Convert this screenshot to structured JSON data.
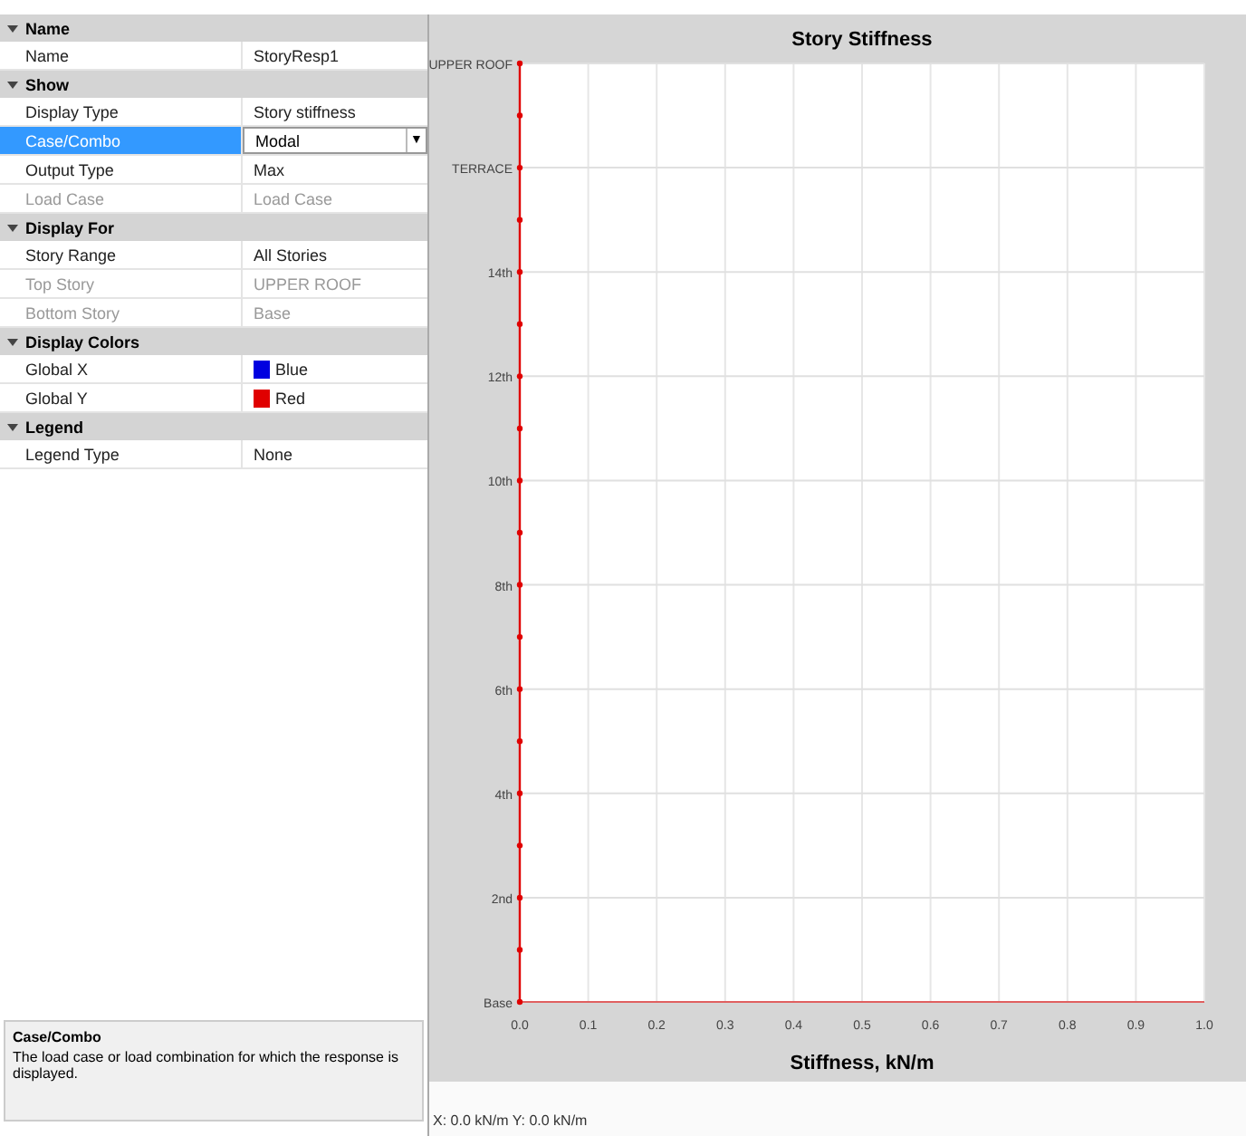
{
  "properties": [
    {
      "kind": "header",
      "label": "Name",
      "expanded": true
    },
    {
      "kind": "text",
      "label": "Name",
      "value": "StoryResp1",
      "disabled": false,
      "selected": false
    },
    {
      "kind": "header",
      "label": "Show",
      "expanded": true
    },
    {
      "kind": "text",
      "label": "Display Type",
      "value": "Story stiffness",
      "disabled": false,
      "selected": false
    },
    {
      "kind": "dropdown",
      "label": "Case/Combo",
      "value": "Modal",
      "caret": "▼",
      "disabled": false,
      "selected": true
    },
    {
      "kind": "text",
      "label": "Output Type",
      "value": "Max",
      "disabled": false,
      "selected": false
    },
    {
      "kind": "text",
      "label": "Load Case",
      "value": "Load Case",
      "disabled": true,
      "selected": false
    },
    {
      "kind": "header",
      "label": "Display For",
      "expanded": true
    },
    {
      "kind": "text",
      "label": "Story Range",
      "value": "All Stories",
      "disabled": false,
      "selected": false
    },
    {
      "kind": "text",
      "label": "Top Story",
      "value": "UPPER ROOF",
      "disabled": true,
      "selected": false
    },
    {
      "kind": "text",
      "label": "Bottom Story",
      "value": "Base",
      "disabled": true,
      "selected": false
    },
    {
      "kind": "header",
      "label": "Display Colors",
      "expanded": true
    },
    {
      "kind": "color",
      "label": "Global X",
      "value": "Blue",
      "color": "#0000e0",
      "disabled": false,
      "selected": false
    },
    {
      "kind": "color",
      "label": "Global Y",
      "value": "Red",
      "color": "#e00000",
      "disabled": false,
      "selected": false
    },
    {
      "kind": "header",
      "label": "Legend",
      "expanded": true
    },
    {
      "kind": "text",
      "label": "Legend Type",
      "value": "None",
      "disabled": false,
      "selected": false
    }
  ],
  "description": {
    "title": "Case/Combo",
    "text": "The load case or load combination for which the response is displayed."
  },
  "chart": {
    "chart_data": {
      "type": "line",
      "orientation": "horizontal",
      "grid": true,
      "title": "Story Stiffness",
      "xlabel": "Stiffness, kN/m",
      "xlim": [
        0,
        1
      ],
      "ylim": [
        0,
        18
      ],
      "xticks": [
        {
          "value": 0,
          "label": "0.0"
        },
        {
          "value": 0.1,
          "label": "0.1"
        },
        {
          "value": 0.2,
          "label": "0.2"
        },
        {
          "value": 0.3,
          "label": "0.3"
        },
        {
          "value": 0.4,
          "label": "0.4"
        },
        {
          "value": 0.5,
          "label": "0.5"
        },
        {
          "value": 0.6,
          "label": "0.6"
        },
        {
          "value": 0.7,
          "label": "0.7"
        },
        {
          "value": 0.8,
          "label": "0.8"
        },
        {
          "value": 0.9,
          "label": "0.9"
        },
        {
          "value": 1,
          "label": "1.0"
        }
      ],
      "yticks": [
        {
          "value": 0,
          "label": "Base"
        },
        {
          "value": 2,
          "label": "2nd"
        },
        {
          "value": 4,
          "label": "4th"
        },
        {
          "value": 6,
          "label": "6th"
        },
        {
          "value": 8,
          "label": "8th"
        },
        {
          "value": 10,
          "label": "10th"
        },
        {
          "value": 12,
          "label": "12th"
        },
        {
          "value": 14,
          "label": "14th"
        },
        {
          "value": 16,
          "label": "TERRACE"
        },
        {
          "value": 18,
          "label": "UPPER ROOF"
        }
      ],
      "x": [
        0,
        1,
        2,
        3,
        4,
        5,
        6,
        7,
        8,
        9,
        10,
        11,
        12,
        13,
        14,
        15,
        16,
        17,
        18
      ],
      "series": [
        {
          "color": "#e00000",
          "marker": "circle",
          "values": [
            0,
            0,
            0,
            0,
            0,
            0,
            0,
            0,
            0,
            0,
            0,
            0,
            0,
            0,
            0,
            0,
            0,
            0,
            0
          ]
        }
      ]
    }
  },
  "status_bar": "X: 0.0 kN/m  Y: 0.0 kN/m"
}
